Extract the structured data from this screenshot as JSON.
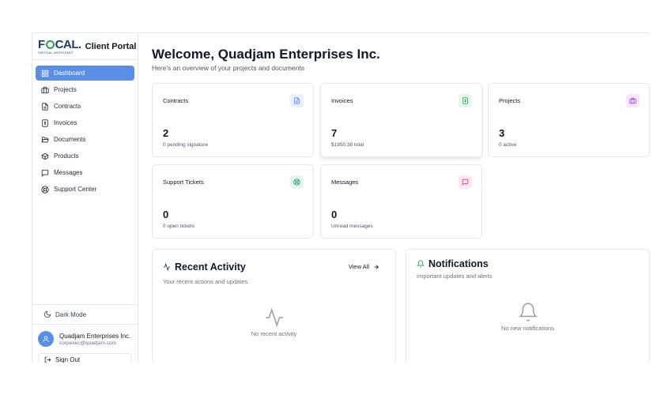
{
  "brand": {
    "logo_text": "FOCAL",
    "logo_subtitle": "VIRTUAL ASSISTANT",
    "portal_title": "Client Portal"
  },
  "sidebar": {
    "items": [
      {
        "label": "Dashboard",
        "icon": "layout-grid-icon",
        "active": true
      },
      {
        "label": "Projects",
        "icon": "briefcase-icon",
        "active": false
      },
      {
        "label": "Contracts",
        "icon": "file-text-icon",
        "active": false
      },
      {
        "label": "Invoices",
        "icon": "dollar-receipt-icon",
        "active": false
      },
      {
        "label": "Documents",
        "icon": "folder-open-icon",
        "active": false
      },
      {
        "label": "Products",
        "icon": "package-icon",
        "active": false
      },
      {
        "label": "Messages",
        "icon": "message-square-icon",
        "active": false
      },
      {
        "label": "Support Center",
        "icon": "life-buoy-icon",
        "active": false
      }
    ],
    "dark_mode_label": "Dark Mode",
    "user": {
      "name": "Quadjam Enterprises Inc.",
      "email": "corpexec@quadjam.com"
    },
    "sign_out_label": "Sign Out"
  },
  "main": {
    "welcome": "Welcome, Quadjam Enterprises Inc.",
    "overview": "Here's an overview of your projects and documents",
    "cards": [
      {
        "title": "Contracts",
        "value": "2",
        "sub": "0 pending signature",
        "icon": "file-text-icon",
        "color": "#3b82f6",
        "bg": "#e8f0fe"
      },
      {
        "title": "Invoices",
        "value": "7",
        "sub": "$1950.38 total",
        "icon": "dollar-receipt-icon",
        "color": "#16a34a",
        "bg": "#e6f6ea"
      },
      {
        "title": "Projects",
        "value": "3",
        "sub": "0 active",
        "icon": "briefcase-icon",
        "color": "#9333ea",
        "bg": "#f3e8fd"
      },
      {
        "title": "Support Tickets",
        "value": "0",
        "sub": "0 open tickets",
        "icon": "life-buoy-icon",
        "color": "#059669",
        "bg": "#e3f5ee"
      },
      {
        "title": "Messages",
        "value": "0",
        "sub": "Unread messages",
        "icon": "message-square-icon",
        "color": "#db2777",
        "bg": "#fce7f0"
      }
    ],
    "activity": {
      "title": "Recent Activity",
      "subtitle": "Your recent actions and updates",
      "view_all": "View All",
      "empty": "No recent activity"
    },
    "notifications": {
      "title": "Notifications",
      "subtitle": "Important updates and alerts",
      "empty": "No new notifications"
    }
  },
  "colors": {
    "accent": "#5b8fe6",
    "logo_blue": "#1f3a68",
    "logo_green": "#2ea043"
  }
}
